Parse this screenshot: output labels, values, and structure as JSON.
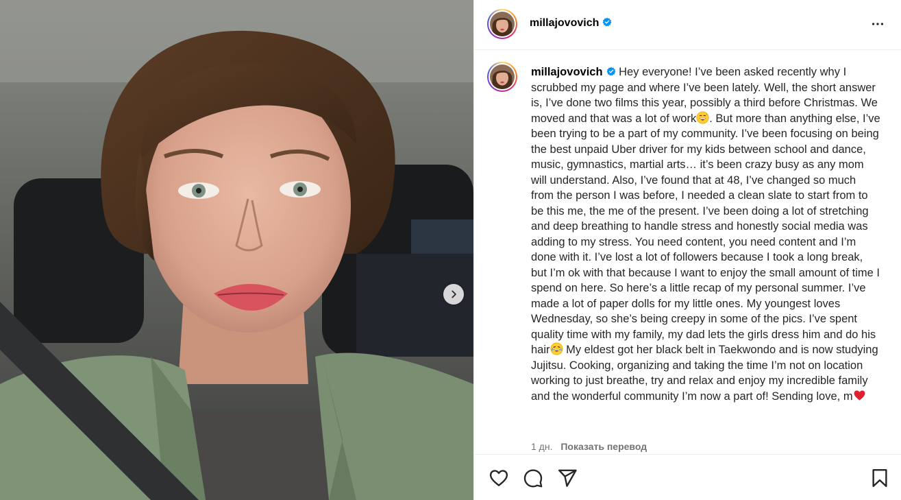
{
  "post": {
    "username": "millajovovich",
    "verified": true,
    "caption_parts": {
      "p1": "Hey everyone! I’ve been asked recently why I scrubbed my page and where I’ve been lately. Well, the short answer is, I’ve done two films this year, possibly a third before Christmas. We moved and that was a lot of work",
      "p2": ". But more than anything else, I’ve been trying to be a part of my community. I’ve been focusing on being the best unpaid Uber driver for my kids between school and dance, music, gymnastics, martial arts… it’s been crazy busy as any mom will understand. Also, I’ve found that at 48, I’ve changed so much from the person I was before, I needed a clean slate to start from to be this me, the me of the present. I’ve been doing a lot of stretching and deep breathing to handle stress and honestly social media was adding to my stress. You need content, you need content and I’m done with it. I’ve lost a lot of followers because I took a long break, but I’m ok with that because I want to enjoy the small amount of time I spend on here. So here’s a little recap of my personal summer. I’ve made a lot of paper dolls for my little ones. My youngest loves Wednesday, so she’s being creepy in some of the pics. I’ve spent quality time with my family, my dad lets the girls dress him and do his hair",
      "p3": " My eldest got her black belt in Taekwondo and is now studying Jujitsu. Cooking, organizing and taking the time I’m not on location working to just breathe, try and relax and enjoy my incredible family and the wonderful community I’m now a part of! Sending love, m"
    },
    "emojis": [
      "grinning-sweat-emoji",
      "tears-of-joy-emoji",
      "red-heart-emoji"
    ],
    "time_ago": "1 дн.",
    "translate_label": "Показать перевод"
  },
  "media": {
    "next_icon": "chevron-right-icon"
  },
  "icons": {
    "more": "more-horizontal-icon",
    "like": "heart-icon",
    "comment": "comment-icon",
    "share": "paper-plane-icon",
    "save": "bookmark-icon"
  },
  "colors": {
    "verified_blue": "#0095f6",
    "text": "#262626",
    "secondary_text": "#737373",
    "divider": "#efefef"
  }
}
